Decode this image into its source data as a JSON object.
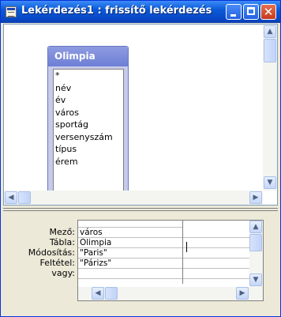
{
  "window": {
    "title": "Lekérdezés1 : frissítő lekérdezés",
    "icon": "query-window-icon",
    "buttons": {
      "minimize": "minimize-icon",
      "maximize": "maximize-icon",
      "close": "close-icon"
    }
  },
  "table": {
    "name": "Olimpia",
    "fields": [
      "*",
      "név",
      "év",
      "város",
      "sportág",
      "versenyszám",
      "típus",
      "érem"
    ]
  },
  "grid": {
    "row_labels": [
      "Mező:",
      "Tábla:",
      "Módosítás:",
      "Feltétel:",
      "vagy:"
    ],
    "column1": {
      "field": "város",
      "table": "Olimpia",
      "update_to": "\"Paris\"",
      "criteria": "\"Párizs\"",
      "or": ""
    }
  },
  "colors": {
    "title_bar": "#0a5ad8",
    "table_header": "#6d7fd6",
    "close_button": "#c33a1c"
  }
}
